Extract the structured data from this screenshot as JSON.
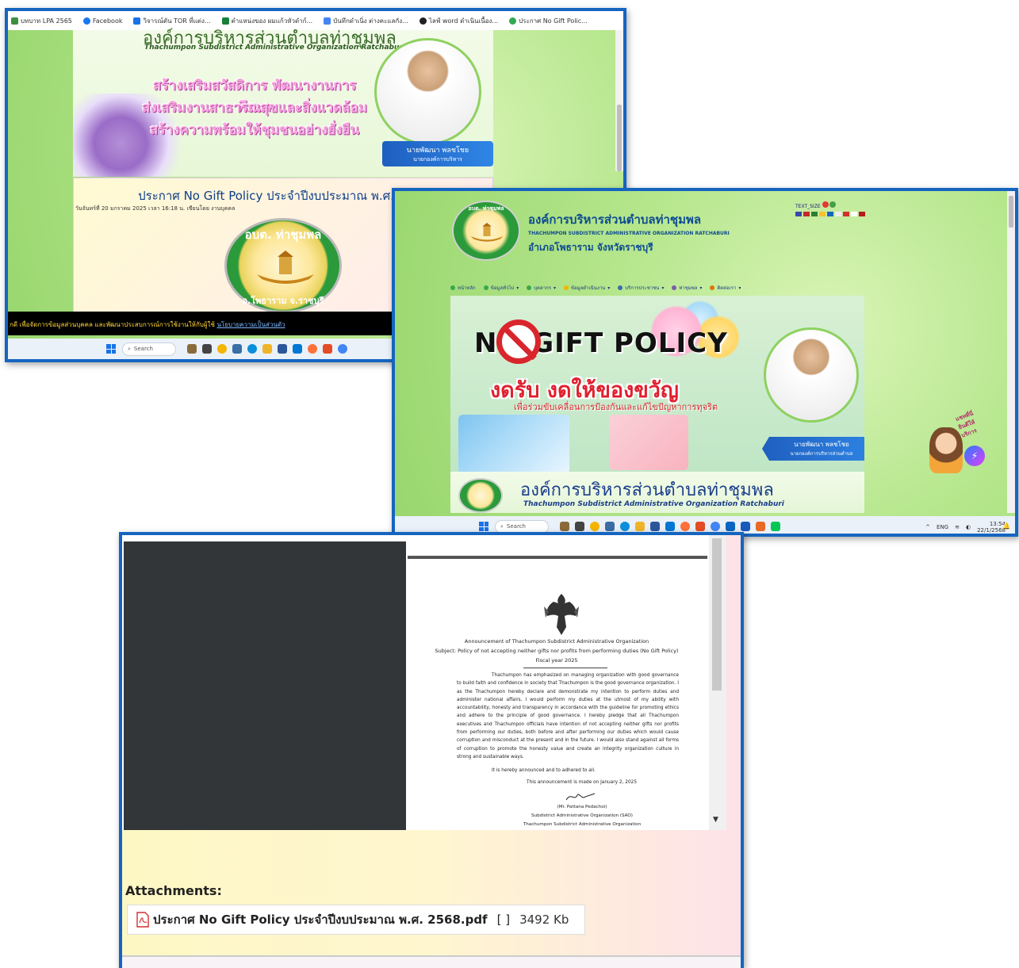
{
  "shot1": {
    "bookmarks": [
      {
        "label": "บทบาท LPA 2565",
        "color": "#3e8e41"
      },
      {
        "label": "Facebook",
        "color": "#1877f2"
      },
      {
        "label": "วิจารณ์ตัน TOR ที่แต่ง...",
        "color": "#1a73e8"
      },
      {
        "label": "ตำแหน่งของ ผมแก้วหัวดำก์...",
        "color": "#188038"
      },
      {
        "label": "บันทึกดำเนิ่ง ต่างคะแลกัง...",
        "color": "#4285f4"
      },
      {
        "label": "ไลฟ์ word ดำเนินเนื้อง...",
        "color": "#202124"
      },
      {
        "label": "ประกาศ No Gift Polic...",
        "color": "#34a853"
      }
    ],
    "banner_partial_title": "องค์การบริหารส่วนตำบลท่าชุมพล",
    "banner_subtitle_en": "Thachumpon Subdistrict Administrative Organization Ratchaburi",
    "slogan_lines": [
      "สร้างเสริมสวัสดิการ พัฒนางานการศึกษา",
      "ส่งเสริมงานสาธารณสุขและสิ่งแวดล้อม",
      "สร้างความพร้อมให้ชุมชนอย่างยั่งยืน"
    ],
    "name_plate": "นายพัฒนา พลชโชย",
    "name_plate_role": "นายกองค์การบริหาร",
    "announcement_title": "ประกาศ No Gift Policy ประจำปีงบประมาณ พ.ศ. 2568",
    "announcement_meta": "วันจันทร์ที่ 20 มกราคม 2025 เวลา 16:18 น. เขียนโดย งานบุคคล",
    "logo_top": "อบต. ท่าชุมพล",
    "logo_bottom": "อ.โพธาราม จ.ราชบุรี",
    "ticker_text": "กดี เพื่อจัดการข้อมูลส่วนบุคคล และพัฒนาประสบการณ์การใช้งานให้กับผู้ใช้",
    "ticker_link": "นโยบายความเป็นส่วนตัว",
    "taskbar_search": "Search"
  },
  "shot2": {
    "org_name_th": "องค์การบริหารส่วนตำบลท่าชุมพล",
    "org_name_en": "THACHUMPON SUBDISTRICT ADMINISTRATIVE ORGANIZATION RATCHABURI",
    "org_district": "อำเภอโพธาราม จังหวัดราชบุรี",
    "logo_label": "อบต. ท่าชุมพล",
    "top_widget": "TEXT_SIZE",
    "nav": [
      "หน้าหลัก",
      "ข้อมูลทั่วไป",
      "บุคลากร",
      "ข้อมูลดำเนินงาน",
      "บริการประชาชน",
      "ท่าชุมพล",
      "ติดต่อเรา"
    ],
    "gift_title": "NO GIFT POLICY",
    "gift_th": "งดรับ งดให้ของขวัญ",
    "gift_th_sub": "เพื่อร่วมขับเคลื่อนการป้องกันและแก้ไขปัญหาการทุจริต",
    "name_plate": "นายพัฒนา พลชโชย",
    "name_plate_role": "นายกองค์การบริหารส่วนตำบล",
    "chat_label": "แชทที่นี่ ยินดีให้บริการ",
    "org_strip_th": "องค์การบริหารส่วนตำบลท่าชุมพล",
    "org_strip_en": "Thachumpon Subdistrict Administrative Organization Ratchaburi",
    "taskbar_search": "Search",
    "tray_lang": "ENG",
    "tray_time": "13:54",
    "tray_date": "22/1/2568"
  },
  "shot3": {
    "doc_heading_1": "Announcement of Thachumpon Subdistrict Administrative Organization",
    "doc_heading_2": "Subject: Policy of not accepting neither gifts nor profits from performing duties (No Gift Policy)",
    "doc_heading_3": "Fiscal year 2025",
    "doc_body": "Thachumpon has emphasized on managing organization with good governance to build faith and confidence in society that Thachumpon is the good governance organization. I as the Thachumpon hereby declare and demonstrate my intention to perform duties and administer national affairs. I would perform my duties at the utmost of my ability with accountability, honesty and transparency in accordance with the guideline for promoting ethics and adhere to the principle of good governance. I hereby pledge that all Thachumpon executives and Thachumpon officials have intention of not accepting neither gifts nor profits from performing our duties, both before and after performing our duties which would cause corruption and misconduct at the present and in the future. I would also stand against all forms of corruption to promote the honesty value and create an integrity organization culture in strong and sustainable ways.",
    "doc_adhered": "It is hereby announced and to adhered to all.",
    "doc_made_on": "This announcement is made on January 2, 2025",
    "sig_name": "(Mr. Pattana Pedachoi)",
    "sig_title": "Subdistrict Administrative Organization (SAO)",
    "sig_org": "Thachumpon Subdistrict Administrative Organization",
    "attachments_label": "Attachments:",
    "attachment_name": "ประกาศ No Gift Policy ประจำปีงบประมาณ พ.ศ. 2568.pdf",
    "attachment_bracket": "[ ]",
    "attachment_size": "3492 Kb"
  },
  "colors": {
    "frame_border": "#1565c0",
    "org_blue": "#0e4c92",
    "policy_red": "#d8262c",
    "pdf_dark_pane": "#323639"
  }
}
